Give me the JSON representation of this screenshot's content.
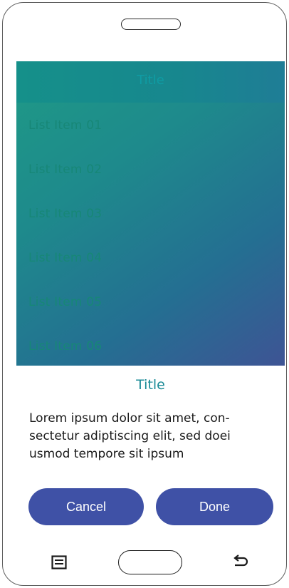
{
  "header": {
    "title": "Title"
  },
  "list": {
    "items": [
      {
        "label": "List Item 01"
      },
      {
        "label": "List Item 02"
      },
      {
        "label": "List Item 03"
      },
      {
        "label": "List Item 04"
      },
      {
        "label": "List Item 05"
      },
      {
        "label": "List Item 06"
      }
    ]
  },
  "dialog": {
    "title": "Title",
    "body": "Lorem ipsum dolor sit amet, con-sectetur adiptiscing elit, sed doei usmod tempore sit ipsum",
    "cancel_label": "Cancel",
    "done_label": "Done"
  },
  "colors": {
    "accent": "#3f51a6",
    "dialog_title": "#1b8b97",
    "gradient_start": "#1f9a86",
    "gradient_end": "#3e5494"
  },
  "icons": {
    "recent_apps": "recent-apps-icon",
    "home": "home-button",
    "back": "back-icon",
    "speaker": "speaker-slot"
  }
}
